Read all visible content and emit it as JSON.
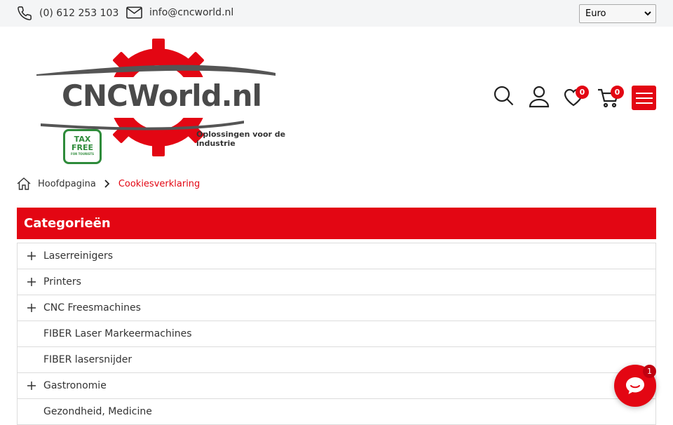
{
  "topbar": {
    "phone": "(0) 612 253 103",
    "email": "info@cncworld.nl",
    "currency": {
      "selected": "Euro"
    }
  },
  "logo": {
    "name": "CNCWorld.nl",
    "tagline": "Oplossingen voor de industrie",
    "taxfree_line1": "TAX",
    "taxfree_line2": "FREE",
    "taxfree_small": "FOR TOURISTS"
  },
  "header": {
    "wishlist_count": "0",
    "cart_count": "0"
  },
  "breadcrumb": {
    "home": "Hoofdpagina",
    "current": "Cookiesverklaring"
  },
  "categories": {
    "title": "Categorieën",
    "items": [
      {
        "label": "Laserreinigers",
        "expandable": true
      },
      {
        "label": "Printers",
        "expandable": true
      },
      {
        "label": "CNC Freesmachines",
        "expandable": true
      },
      {
        "label": "FIBER Laser Markeermachines",
        "expandable": false
      },
      {
        "label": "FIBER lasersnijder",
        "expandable": false
      },
      {
        "label": "Gastronomie",
        "expandable": true
      },
      {
        "label": "Gezondheid, Medicine",
        "expandable": false
      }
    ]
  },
  "chat": {
    "unread": "1"
  },
  "colors": {
    "accent": "#e30613",
    "taxfree": "#2e8b3a",
    "topbar": "#f4f5f6"
  }
}
